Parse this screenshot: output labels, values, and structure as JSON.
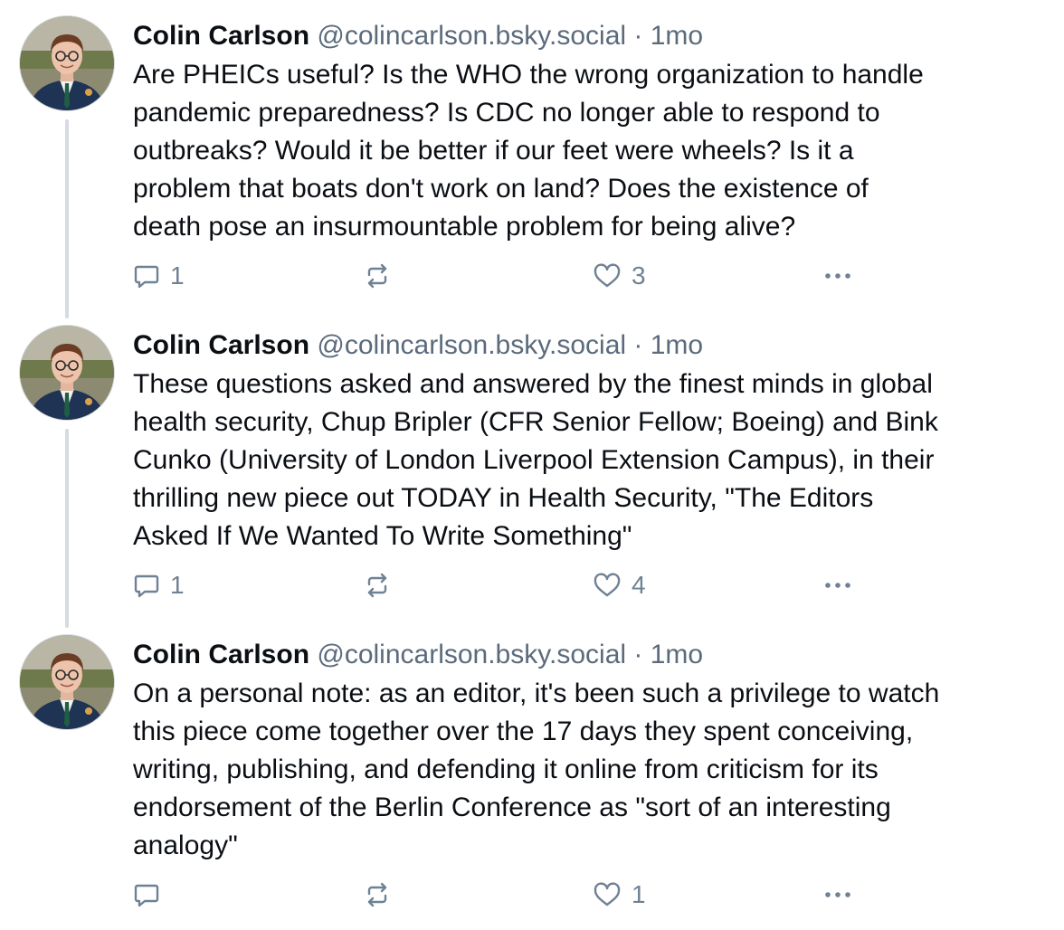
{
  "posts": [
    {
      "author": {
        "name": "Colin Carlson",
        "handle": "@colincarlson.bsky.social"
      },
      "separator": "·",
      "time": "1mo",
      "text": "Are PHEICs useful? Is the WHO the wrong organization to handle\npandemic preparedness? Is CDC no longer able to respond to\noutbreaks? Would it be better if our feet were wheels? Is it a\nproblem that boats don't work on land? Does the existence of\ndeath pose an insurmountable problem for being alive?",
      "reply_count": "1",
      "repost_count": "",
      "like_count": "3",
      "icons": {
        "reply": "reply-icon",
        "repost": "repost-icon",
        "like": "heart-icon",
        "more": "more-icon"
      }
    },
    {
      "author": {
        "name": "Colin Carlson",
        "handle": "@colincarlson.bsky.social"
      },
      "separator": "·",
      "time": "1mo",
      "text": "These questions asked and answered by the finest minds in global\nhealth security, Chup Bripler (CFR Senior Fellow; Boeing) and Bink\nCunko (University of London Liverpool Extension Campus), in their\nthrilling new piece out TODAY in Health Security, \"The Editors\nAsked If We Wanted To Write Something\"",
      "reply_count": "1",
      "repost_count": "",
      "like_count": "4",
      "icons": {
        "reply": "reply-icon",
        "repost": "repost-icon",
        "like": "heart-icon",
        "more": "more-icon"
      }
    },
    {
      "author": {
        "name": "Colin Carlson",
        "handle": "@colincarlson.bsky.social"
      },
      "separator": "·",
      "time": "1mo",
      "text": "On a personal note: as an editor, it's been such a privilege to watch\nthis piece come together over the 17 days they spent conceiving,\nwriting, publishing, and defending it online from criticism for its\nendorsement of the Berlin Conference as \"sort of an interesting\nanalogy\"",
      "reply_count": "",
      "repost_count": "",
      "like_count": "1",
      "icons": {
        "reply": "reply-icon",
        "repost": "repost-icon",
        "like": "heart-icon",
        "more": "more-icon"
      }
    }
  ],
  "colors": {
    "text": "#0b0f14",
    "muted": "#5b6b7c",
    "icon": "#6f8194",
    "thread_line": "#d4dbe2"
  }
}
